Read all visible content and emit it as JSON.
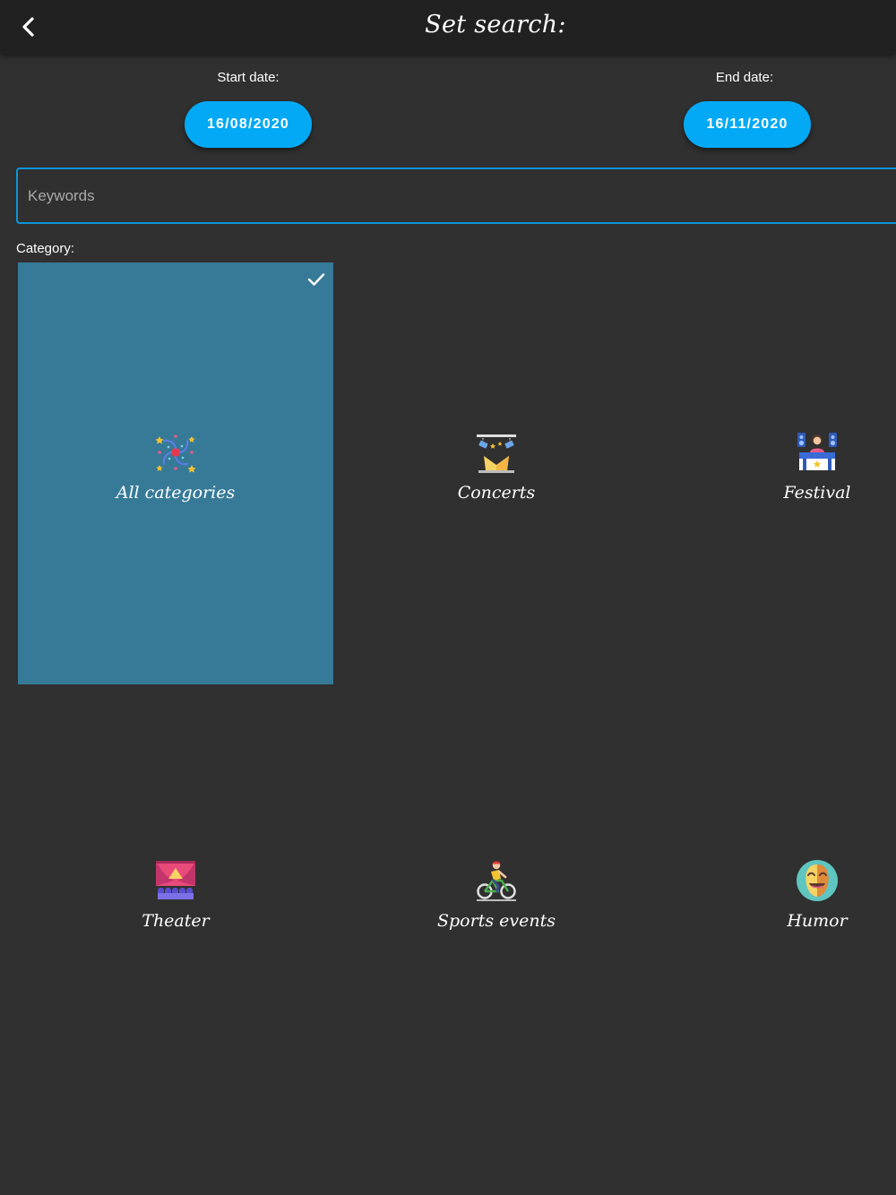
{
  "header": {
    "title": "Set search:",
    "back_icon": "chevron-left-icon"
  },
  "dates": {
    "start_label": "Start date:",
    "start_value": "16/08/2020",
    "end_label": "End date:",
    "end_value": "16/11/2020"
  },
  "search": {
    "placeholder": "Keywords",
    "value": ""
  },
  "category": {
    "label": "Category:",
    "items": [
      {
        "label": "All categories",
        "icon": "fireworks-icon",
        "selected": true
      },
      {
        "label": "Concerts",
        "icon": "stage-lights-icon",
        "selected": false
      },
      {
        "label": "Festival",
        "icon": "dj-booth-icon",
        "selected": false
      },
      {
        "label": "Theater",
        "icon": "theater-stage-icon",
        "selected": false
      },
      {
        "label": "Sports events",
        "icon": "cyclist-icon",
        "selected": false
      },
      {
        "label": "Humor",
        "icon": "comedy-mask-icon",
        "selected": false
      }
    ]
  },
  "colors": {
    "background": "#303030",
    "header": "#212121",
    "accent": "#03a9f4",
    "selected_tile": "#367a98"
  }
}
